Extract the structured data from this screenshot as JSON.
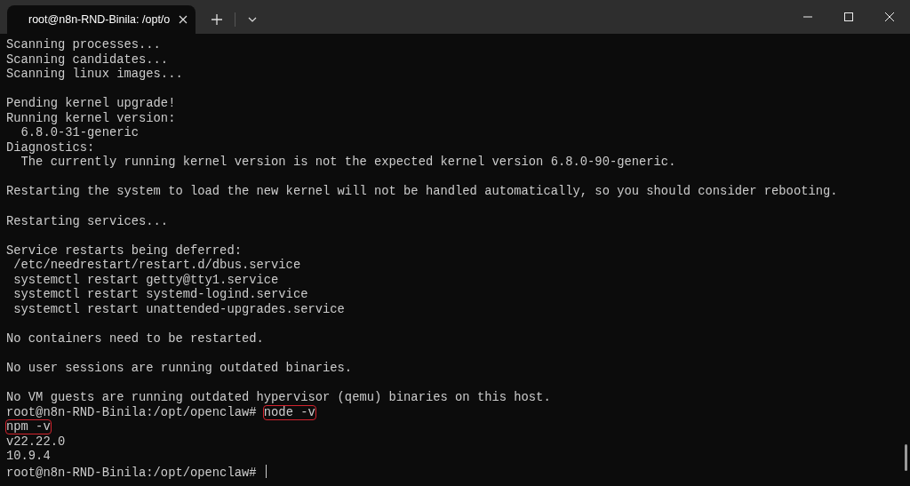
{
  "tab": {
    "title": "root@n8n-RND-Binila: /opt/o",
    "selected": true
  },
  "lines": [
    {
      "kind": "text",
      "text": "Scanning processes..."
    },
    {
      "kind": "text",
      "text": "Scanning candidates..."
    },
    {
      "kind": "text",
      "text": "Scanning linux images..."
    },
    {
      "kind": "blank"
    },
    {
      "kind": "text",
      "text": "Pending kernel upgrade!"
    },
    {
      "kind": "text",
      "text": "Running kernel version:"
    },
    {
      "kind": "text",
      "text": "  6.8.0-31-generic"
    },
    {
      "kind": "text",
      "text": "Diagnostics:"
    },
    {
      "kind": "text",
      "text": "  The currently running kernel version is not the expected kernel version 6.8.0-90-generic."
    },
    {
      "kind": "blank"
    },
    {
      "kind": "text",
      "text": "Restarting the system to load the new kernel will not be handled automatically, so you should consider rebooting."
    },
    {
      "kind": "blank"
    },
    {
      "kind": "text",
      "text": "Restarting services..."
    },
    {
      "kind": "blank"
    },
    {
      "kind": "text",
      "text": "Service restarts being deferred:"
    },
    {
      "kind": "text",
      "text": " /etc/needrestart/restart.d/dbus.service"
    },
    {
      "kind": "text",
      "text": " systemctl restart getty@tty1.service"
    },
    {
      "kind": "text",
      "text": " systemctl restart systemd-logind.service"
    },
    {
      "kind": "text",
      "text": " systemctl restart unattended-upgrades.service"
    },
    {
      "kind": "blank"
    },
    {
      "kind": "text",
      "text": "No containers need to be restarted."
    },
    {
      "kind": "blank"
    },
    {
      "kind": "text",
      "text": "No user sessions are running outdated binaries."
    },
    {
      "kind": "blank"
    },
    {
      "kind": "text",
      "text": "No VM guests are running outdated hypervisor (qemu) binaries on this host."
    },
    {
      "kind": "prompt",
      "prompt": "root@n8n-RND-Binila:/opt/openclaw#",
      "command": "node -v",
      "highlighted": true
    },
    {
      "kind": "text",
      "text": "npm -v",
      "highlighted": true
    },
    {
      "kind": "text",
      "text": "v22.22.0"
    },
    {
      "kind": "text",
      "text": "10.9.4"
    },
    {
      "kind": "prompt",
      "prompt": "root@n8n-RND-Binila:/opt/openclaw#",
      "cursor": true
    }
  ]
}
